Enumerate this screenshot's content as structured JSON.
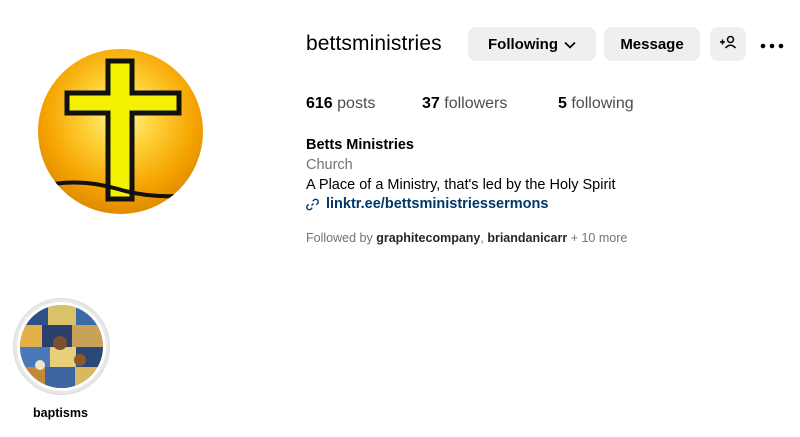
{
  "profile": {
    "username": "bettsministries",
    "buttons": {
      "following_label": "Following",
      "message_label": "Message"
    },
    "stats": {
      "posts_count": "616",
      "posts_label": "posts",
      "followers_count": "37",
      "followers_label": "followers",
      "following_count": "5",
      "following_label": "following"
    },
    "bio": {
      "name": "Betts Ministries",
      "category": "Church",
      "text": "A Place of a Ministry, that's led by the Holy Spirit",
      "link": "linktr.ee/bettsministriessermons"
    },
    "followed_by": {
      "prefix": "Followed by",
      "accounts": [
        "graphitecompany",
        "briandanicarr"
      ],
      "more": "+ 10 more"
    }
  },
  "highlights": [
    {
      "label": "baptisms"
    }
  ],
  "icons": {
    "following_chevron": "chevron-down-icon",
    "add_user": "add-user-icon",
    "more": "more-options-icon",
    "link": "link-icon"
  },
  "colors": {
    "button_bg": "#efefef",
    "link": "#00376b",
    "secondary_text": "#737373",
    "avatar_orange": "#f5a400",
    "cross_yellow": "#f4f200"
  }
}
